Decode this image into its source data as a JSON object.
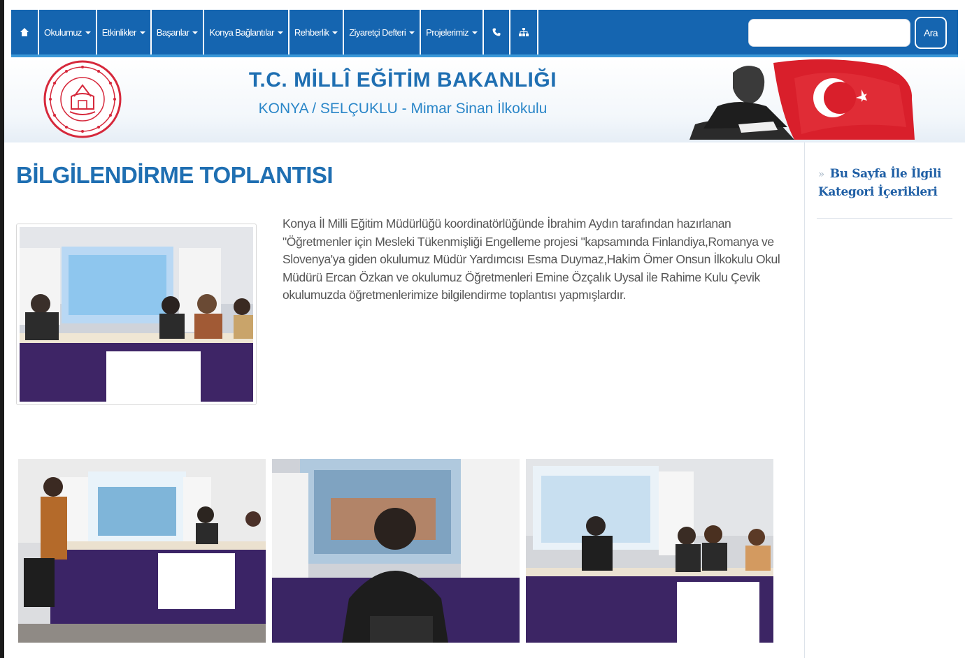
{
  "nav": {
    "items": [
      {
        "label": "Okulumuz",
        "dropdown": true
      },
      {
        "label": "Etkinlikler",
        "dropdown": true
      },
      {
        "label": "Başarılar",
        "dropdown": true
      },
      {
        "label": "Konya Bağlantılar",
        "dropdown": true
      },
      {
        "label": "Rehberlik",
        "dropdown": true
      },
      {
        "label": "Ziyaretçi Defteri",
        "dropdown": true
      },
      {
        "label": "Projelerimiz",
        "dropdown": true
      }
    ],
    "search_placeholder": "",
    "search_button": "Ara",
    "icons": [
      "home-icon",
      "phone-icon",
      "sitemap-icon"
    ]
  },
  "header": {
    "title": "T.C. MİLLÎ EĞİTİM BAKANLIĞI",
    "subtitle": "KONYA / SELÇUKLU - Mimar Sinan İlkokulu"
  },
  "article": {
    "title": "BİLGİLENDİRME TOPLANTISI",
    "body": "Konya İl Milli Eğitim Müdürlüğü  koordinatörlüğünde İbrahim Aydın tarafından hazırlanan \"Öğretmenler için Mesleki Tükenmişliği Engelleme projesi \"kapsamında Finlandiya,Romanya ve Slovenya'ya giden okulumuz Müdür Yardımcısı Esma Duymaz,Hakim Ömer Onsun İlkokulu Okul Müdürü Ercan Özkan ve okulumuz Öğretmenleri Emine Özçalık Uysal ile Rahime Kulu Çevik okulumuzda öğretmenlerimize bilgilendirme toplantısı yapmışlardır."
  },
  "sidebar": {
    "heading": "Bu Sayfa İle İlgili Kategori İçerikleri"
  },
  "colors": {
    "nav_bg": "#1565b0",
    "nav_border": "#3a98d8",
    "title_blue": "#1f6fb2",
    "table_purple": "#3e2566"
  }
}
